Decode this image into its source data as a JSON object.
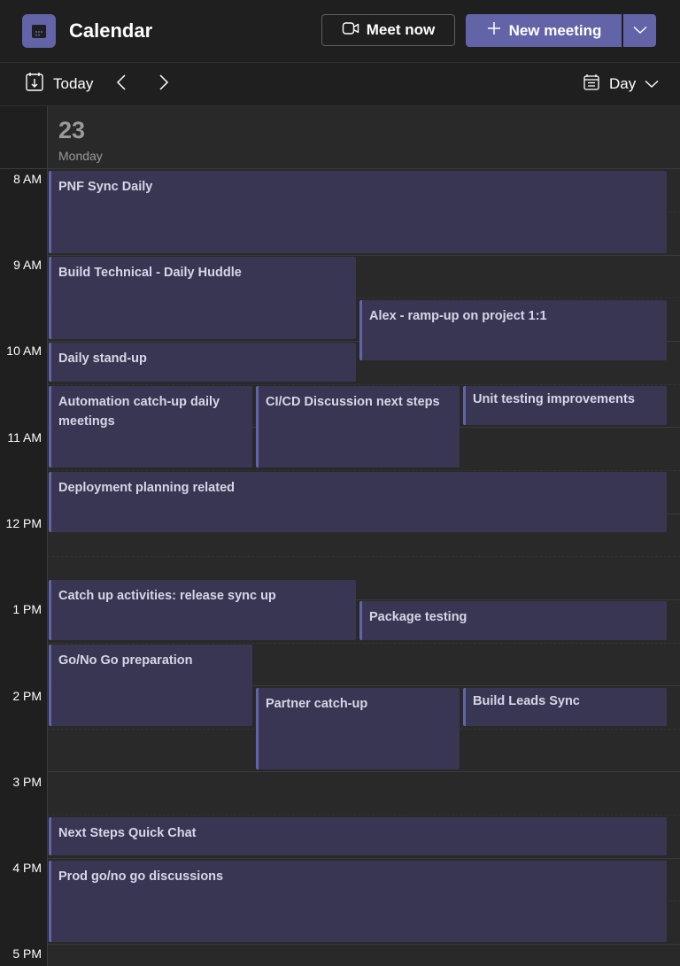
{
  "header": {
    "app_title": "Calendar",
    "app_icon": "calendar-icon",
    "meet_now_label": "Meet now",
    "meet_now_icon": "video-camera-icon",
    "new_meeting_label": "New meeting",
    "new_meeting_icon": "plus-icon"
  },
  "toolbar": {
    "today_label": "Today",
    "view_label": "Day"
  },
  "day": {
    "number": "23",
    "name": "Monday"
  },
  "time_labels": [
    "8 AM",
    "9 AM",
    "10 AM",
    "11 AM",
    "12 PM",
    "1 PM",
    "2 PM",
    "3 PM",
    "4 PM",
    "5 PM"
  ],
  "events": [
    {
      "title": "PNF Sync Daily"
    },
    {
      "title": "Build Technical - Daily Huddle"
    },
    {
      "title": "Alex - ramp-up on project 1:1"
    },
    {
      "title": "Daily stand-up"
    },
    {
      "title": "Automation catch-up daily meetings"
    },
    {
      "title": "CI/CD Discussion next steps"
    },
    {
      "title": "Unit testing improvements"
    },
    {
      "title": "Deployment planning related"
    },
    {
      "title": "Catch up activities: release sync up"
    },
    {
      "title": "Package testing"
    },
    {
      "title": "Go/No Go preparation"
    },
    {
      "title": "Partner catch-up"
    },
    {
      "title": "Build Leads Sync"
    },
    {
      "title": "Next Steps Quick Chat"
    },
    {
      "title": "Prod go/no go discussions"
    }
  ],
  "colors": {
    "accent": "#6264a7",
    "event_bg": "#393654",
    "background": "#1f1f1f",
    "day_column": "#292929"
  }
}
